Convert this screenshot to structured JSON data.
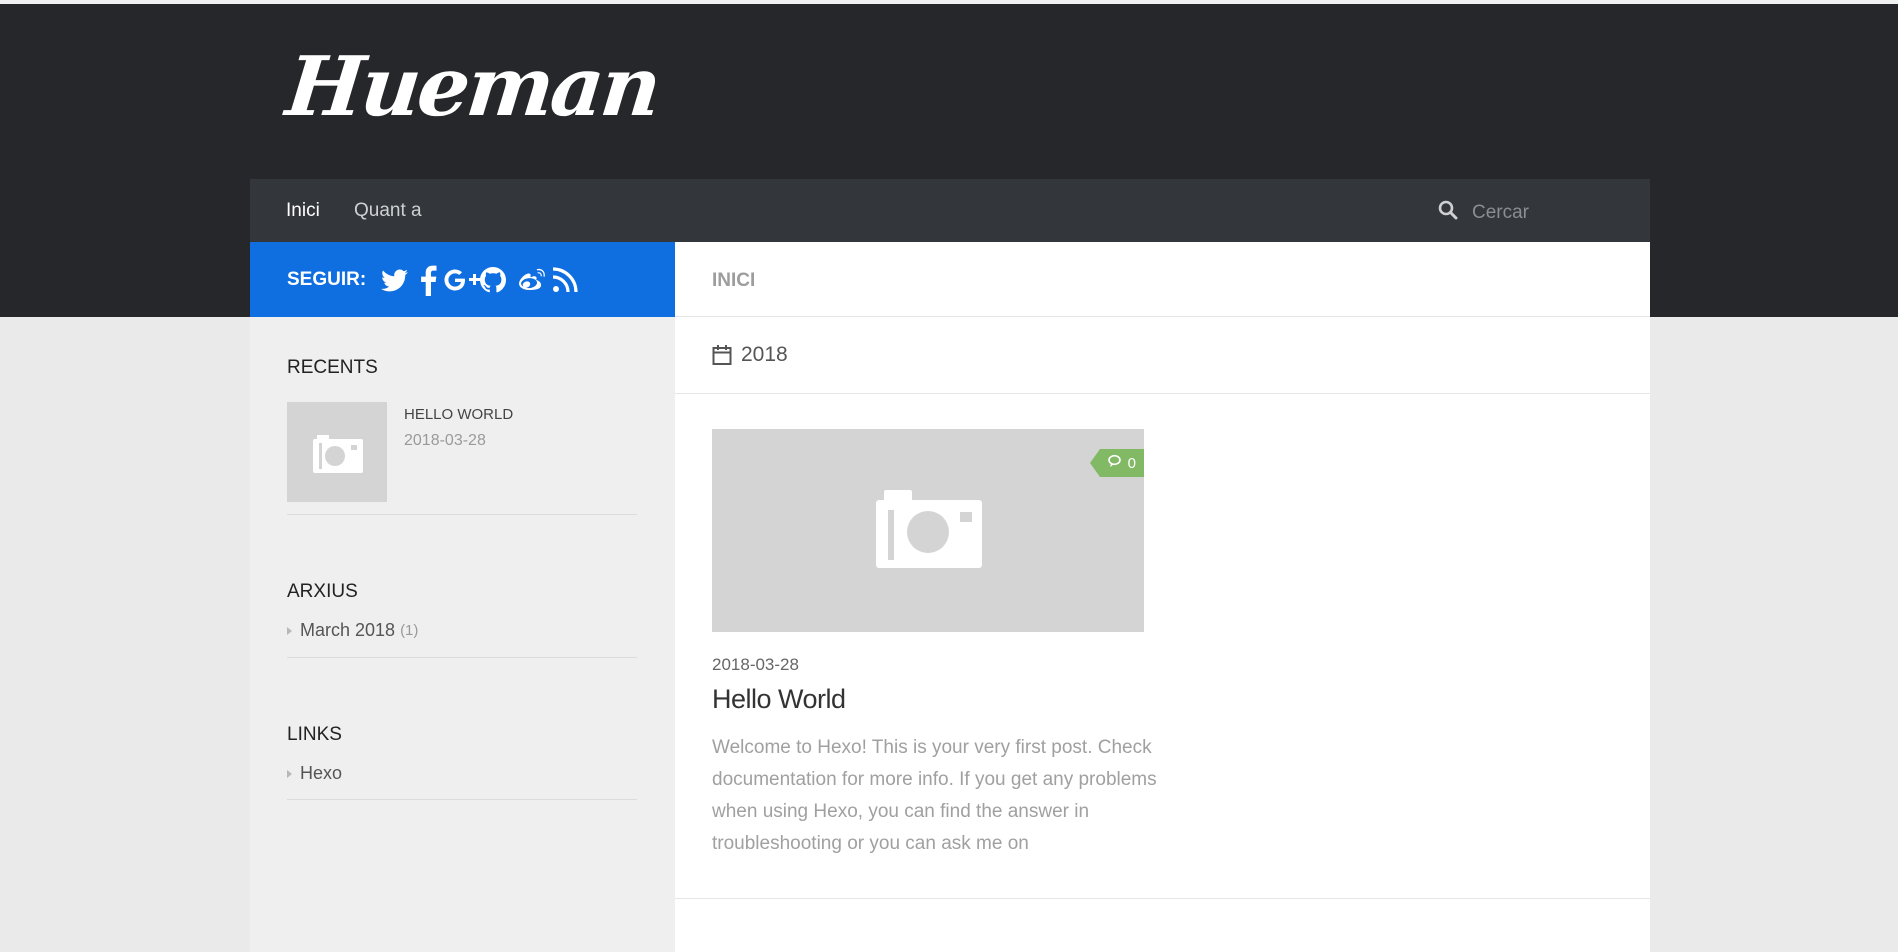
{
  "site": {
    "logo": "Hueman"
  },
  "nav": {
    "items": [
      {
        "label": "Inici",
        "active": true
      },
      {
        "label": "Quant a",
        "active": false
      }
    ],
    "search": {
      "placeholder": "Cercar",
      "icon": "search-icon"
    }
  },
  "follow": {
    "label": "SEGUIR:",
    "icons": [
      "twitter-icon",
      "facebook-icon",
      "google-plus-icon",
      "github-icon",
      "weibo-icon",
      "rss-icon"
    ],
    "bar_color": "#0f6ee0"
  },
  "sidebar": {
    "recents": {
      "title": "RECENTS",
      "items": [
        {
          "title": "HELLO WORLD",
          "date": "2018-03-28",
          "thumb_icon": "camera-icon"
        }
      ]
    },
    "archives": {
      "title": "ARXIUS",
      "items": [
        {
          "label": "March 2018",
          "count": "(1)"
        }
      ]
    },
    "links": {
      "title": "LINKS",
      "items": [
        {
          "label": "Hexo"
        }
      ]
    }
  },
  "main": {
    "page_title": "INICI",
    "archive_heading": {
      "icon": "calendar-icon",
      "year": "2018"
    },
    "posts": [
      {
        "comments": "0",
        "comment_icon": "comments-icon",
        "date": "2018-03-28",
        "title": "Hello World",
        "excerpt": "Welcome to Hexo! This is your very first post. Check documentation for more info. If you get any problems when using Hexo, you can find the answer in troubleshooting or you can ask me on",
        "thumb_icon": "camera-icon"
      }
    ]
  },
  "colors": {
    "header": "#26272b",
    "nav": "#33363b",
    "accent": "#0f6ee0",
    "comment_badge": "#82b965"
  }
}
